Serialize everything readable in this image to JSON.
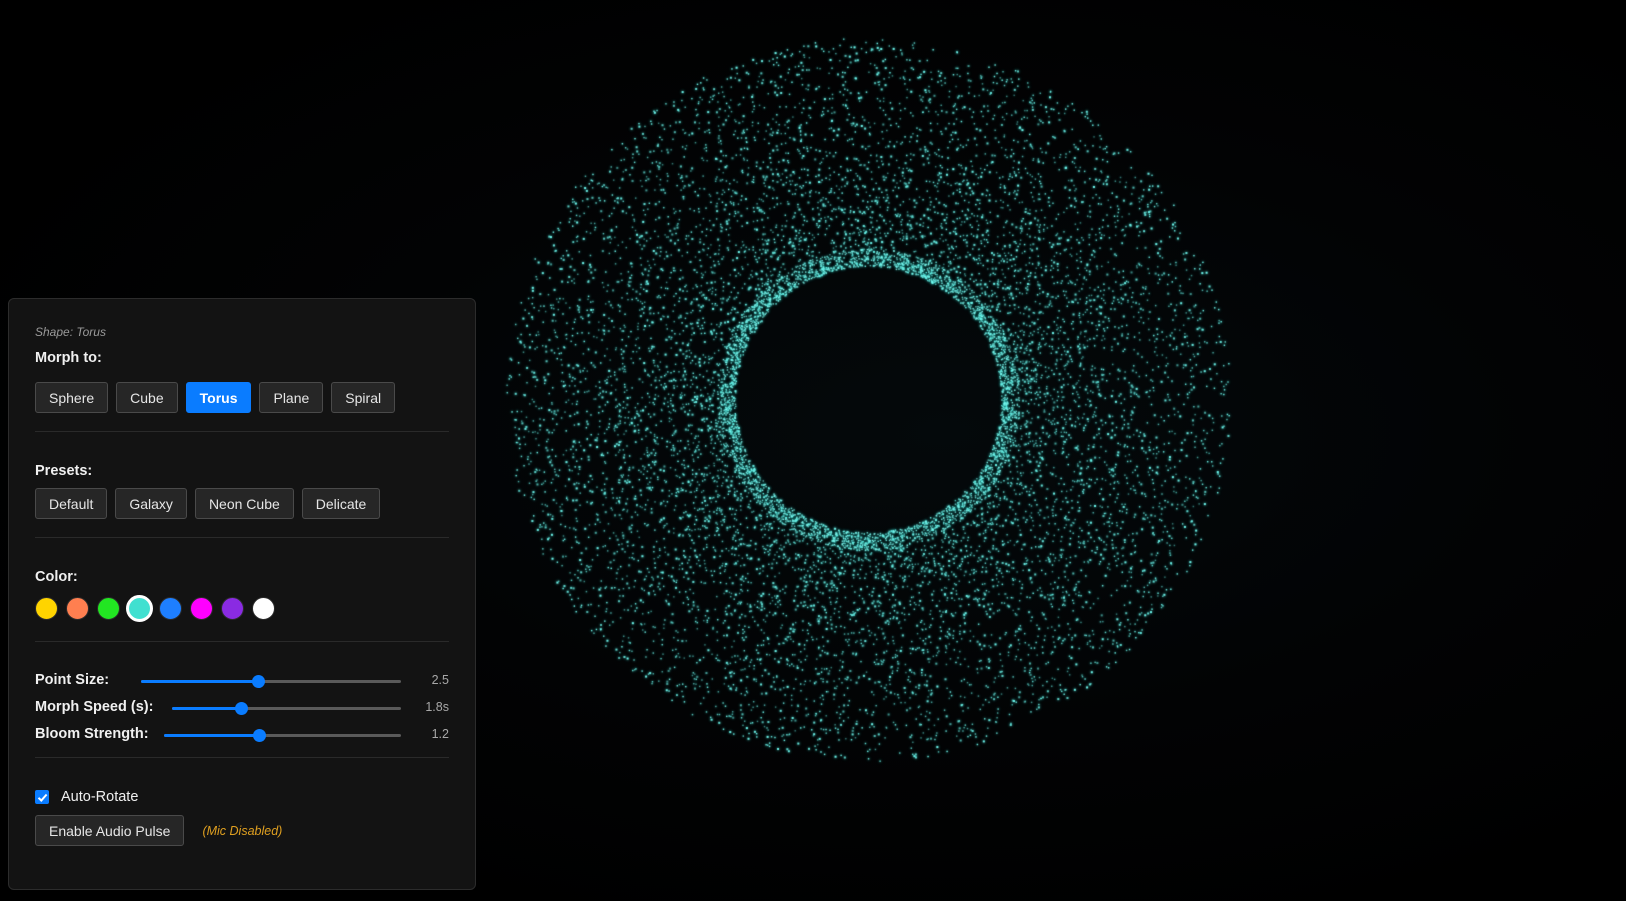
{
  "scene": {
    "shape": "torus",
    "particle_color": "#5ef0e6",
    "background_color": "#000000"
  },
  "panel": {
    "shape_status": "Shape: Torus",
    "morph": {
      "label": "Morph to:",
      "options": [
        "Sphere",
        "Cube",
        "Torus",
        "Plane",
        "Spiral"
      ],
      "active": "Torus"
    },
    "presets": {
      "label": "Presets:",
      "options": [
        "Default",
        "Galaxy",
        "Neon Cube",
        "Delicate"
      ]
    },
    "color": {
      "label": "Color:",
      "swatches": [
        "#ffd400",
        "#ff7f50",
        "#22e622",
        "#40e0d0",
        "#1e7fff",
        "#ff00ff",
        "#8a2be2",
        "#ffffff"
      ],
      "selected": "#40e0d0"
    },
    "sliders": [
      {
        "label": "Point Size:",
        "value_text": "2.5",
        "fraction": 0.45
      },
      {
        "label": "Morph Speed (s):",
        "value_text": "1.8s",
        "fraction": 0.3
      },
      {
        "label": "Bloom Strength:",
        "value_text": "1.2",
        "fraction": 0.4
      }
    ],
    "auto_rotate": {
      "label": "Auto-Rotate",
      "checked": true
    },
    "audio": {
      "button_label": "Enable Audio Pulse",
      "status": "(Mic Disabled)"
    }
  }
}
